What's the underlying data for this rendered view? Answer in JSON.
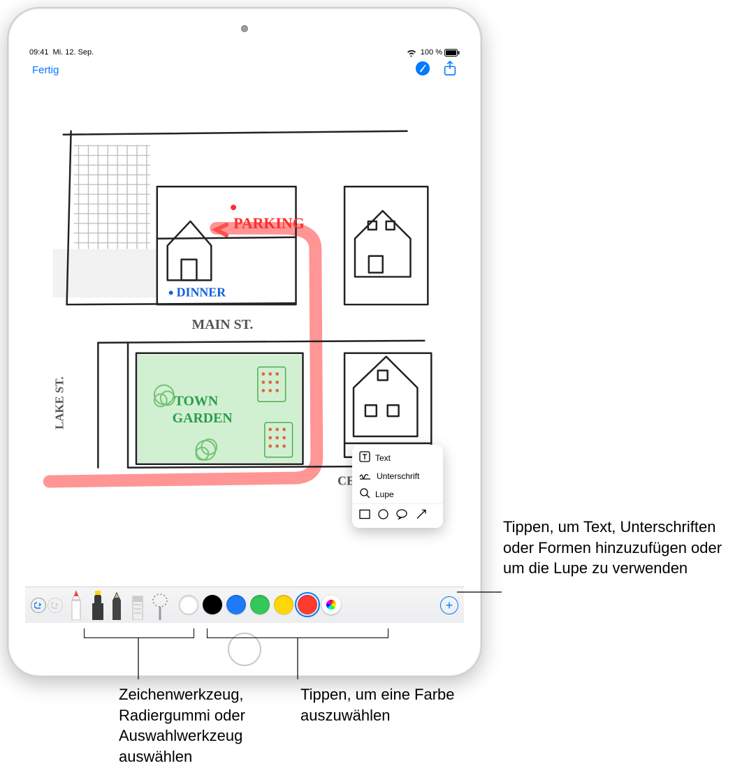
{
  "status": {
    "time": "09:41",
    "date": "Mi. 12. Sep.",
    "battery": "100 %"
  },
  "nav": {
    "done": "Fertig"
  },
  "drawing": {
    "labels": {
      "lake_st": "LAKE ST.",
      "main_st": "MAIN ST.",
      "center_ave": "CENTER AVE.",
      "parking": "PARKING",
      "dinner": "DINNER",
      "town": "TOWN",
      "garden": "GARDEN"
    }
  },
  "popup": {
    "text": "Text",
    "signature": "Unterschrift",
    "loupe": "Lupe"
  },
  "toolbar": {
    "colors": [
      "#ffffff",
      "#000000",
      "#1f7af5",
      "#34c759",
      "#ffd60a",
      "#ff3b30"
    ]
  },
  "callouts": {
    "add": "Tippen, um Text, Unterschriften oder Formen hinzuzufügen oder um die Lupe zu verwenden",
    "tools": "Zeichenwerkzeug, Radiergummi oder Auswahlwerkzeug auswählen",
    "colors": "Tippen, um eine Farbe auszuwählen"
  }
}
